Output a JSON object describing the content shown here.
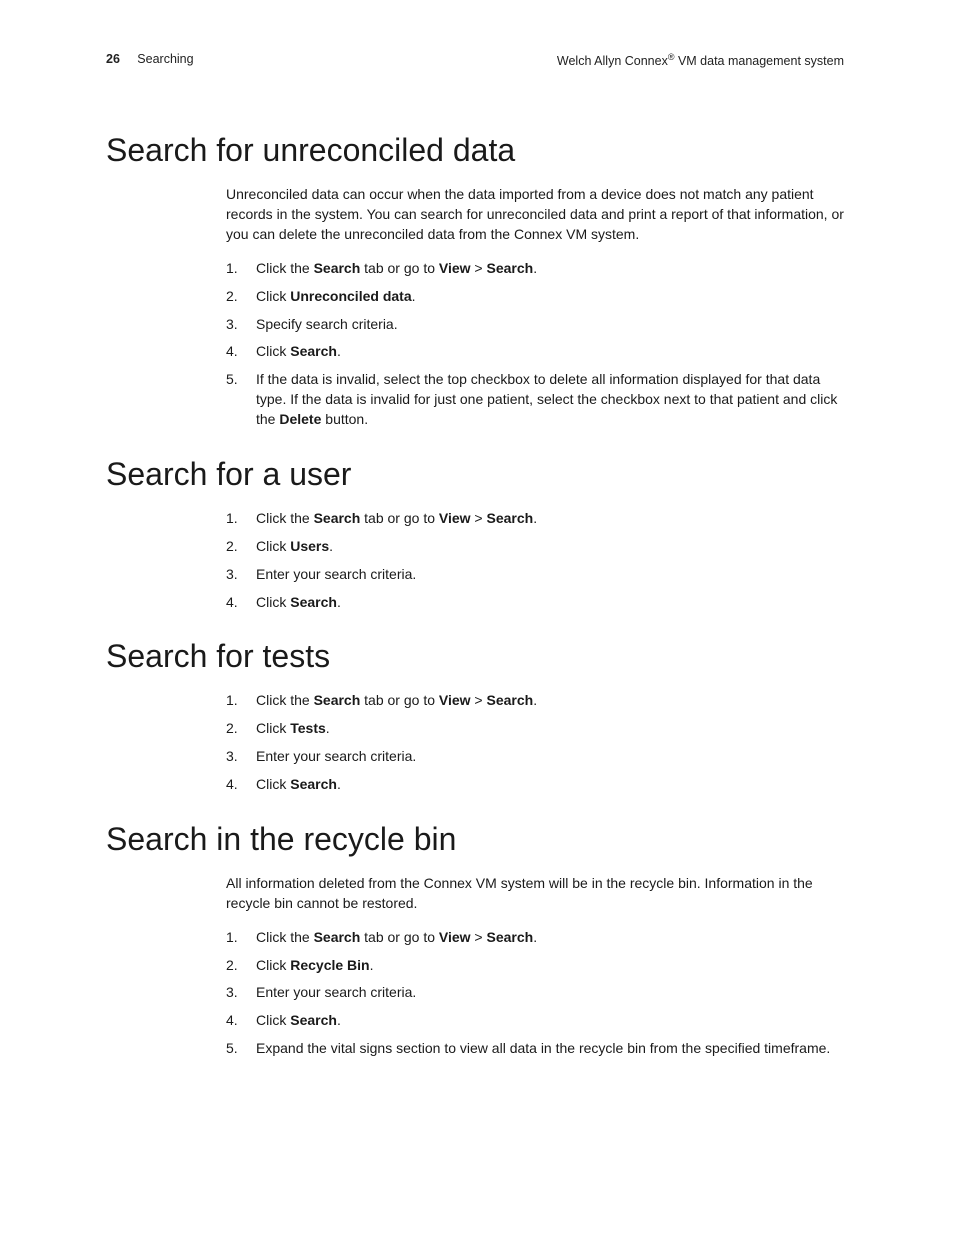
{
  "header": {
    "pagenum": "26",
    "section": "Searching",
    "product_prefix": "Welch Allyn Connex",
    "product_reg": "®",
    "product_suffix": " VM data management system"
  },
  "sections": [
    {
      "title": "Search for unreconciled data",
      "intro": "Unreconciled data can occur when the data imported from a device does not match any patient records in the system. You can search for unreconciled data and print a report of that information, or you can delete the unreconciled data from the Connex VM system.",
      "steps": [
        [
          {
            "t": "Click the "
          },
          {
            "t": "Search",
            "b": true
          },
          {
            "t": " tab or go to "
          },
          {
            "t": "View",
            "b": true
          },
          {
            "t": " > "
          },
          {
            "t": "Search",
            "b": true
          },
          {
            "t": "."
          }
        ],
        [
          {
            "t": "Click "
          },
          {
            "t": "Unreconciled data",
            "b": true
          },
          {
            "t": "."
          }
        ],
        [
          {
            "t": "Specify search criteria."
          }
        ],
        [
          {
            "t": "Click "
          },
          {
            "t": "Search",
            "b": true
          },
          {
            "t": "."
          }
        ],
        [
          {
            "t": "If the data is invalid, select the top checkbox to delete all information displayed for that data type. If the data is invalid for just one patient, select the checkbox next to that patient and click the "
          },
          {
            "t": "Delete",
            "b": true
          },
          {
            "t": " button."
          }
        ]
      ]
    },
    {
      "title": "Search for a user",
      "steps": [
        [
          {
            "t": "Click the "
          },
          {
            "t": "Search",
            "b": true
          },
          {
            "t": " tab or go to "
          },
          {
            "t": "View",
            "b": true
          },
          {
            "t": " > "
          },
          {
            "t": "Search",
            "b": true
          },
          {
            "t": "."
          }
        ],
        [
          {
            "t": "Click "
          },
          {
            "t": "Users",
            "b": true
          },
          {
            "t": "."
          }
        ],
        [
          {
            "t": "Enter your search criteria."
          }
        ],
        [
          {
            "t": "Click "
          },
          {
            "t": "Search",
            "b": true
          },
          {
            "t": "."
          }
        ]
      ]
    },
    {
      "title": "Search for tests",
      "steps": [
        [
          {
            "t": "Click the "
          },
          {
            "t": "Search",
            "b": true
          },
          {
            "t": " tab or go to "
          },
          {
            "t": "View",
            "b": true
          },
          {
            "t": " > "
          },
          {
            "t": "Search",
            "b": true
          },
          {
            "t": "."
          }
        ],
        [
          {
            "t": "Click "
          },
          {
            "t": "Tests",
            "b": true
          },
          {
            "t": "."
          }
        ],
        [
          {
            "t": "Enter your search criteria."
          }
        ],
        [
          {
            "t": "Click "
          },
          {
            "t": "Search",
            "b": true
          },
          {
            "t": "."
          }
        ]
      ]
    },
    {
      "title": "Search in the recycle bin",
      "intro": "All information deleted from the Connex VM system will be in the recycle bin. Information in the recycle bin cannot be restored.",
      "steps": [
        [
          {
            "t": "Click the "
          },
          {
            "t": "Search",
            "b": true
          },
          {
            "t": " tab or go to "
          },
          {
            "t": "View",
            "b": true
          },
          {
            "t": " > "
          },
          {
            "t": "Search",
            "b": true
          },
          {
            "t": "."
          }
        ],
        [
          {
            "t": "Click "
          },
          {
            "t": "Recycle Bin",
            "b": true
          },
          {
            "t": "."
          }
        ],
        [
          {
            "t": "Enter your search criteria."
          }
        ],
        [
          {
            "t": "Click "
          },
          {
            "t": "Search",
            "b": true
          },
          {
            "t": "."
          }
        ],
        [
          {
            "t": "Expand the vital signs section to view all data in the recycle bin from the specified timeframe."
          }
        ]
      ]
    }
  ]
}
